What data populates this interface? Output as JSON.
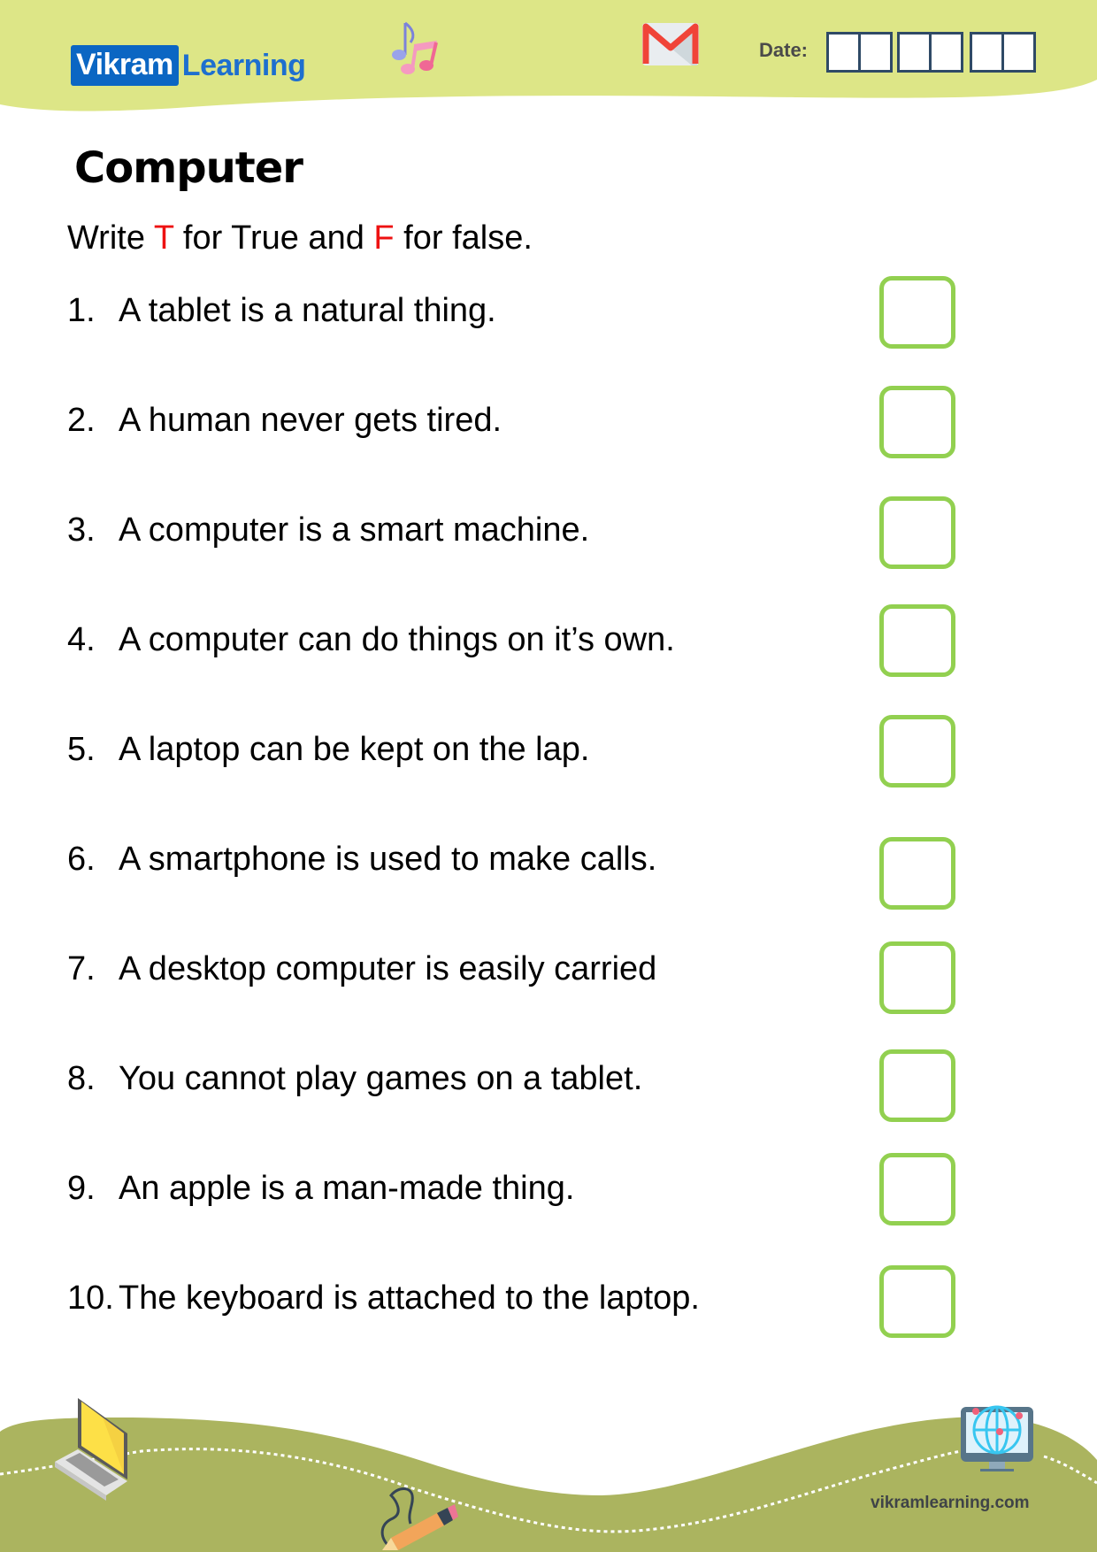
{
  "header": {
    "brand_box": "Vikram",
    "brand_text": "Learning",
    "date_label": "Date:",
    "date_groups": [
      2,
      2,
      2
    ]
  },
  "worksheet": {
    "title": "Computer",
    "instruction": {
      "part1": "Write ",
      "t": "T",
      "part2": " for True and ",
      "f": "F",
      "part3": " for false."
    },
    "questions": [
      {
        "num": "1.",
        "text": "A tablet is a natural thing."
      },
      {
        "num": "2.",
        "text": "A human never gets tired."
      },
      {
        "num": "3.",
        "text": "A computer is a smart machine."
      },
      {
        "num": "4.",
        "text": "A computer can do things on it’s own."
      },
      {
        "num": "5.",
        "text": "A laptop can be kept on the lap."
      },
      {
        "num": "6.",
        "text": "A smartphone is used to make calls."
      },
      {
        "num": "7.",
        "text": "A desktop computer is easily carried"
      },
      {
        "num": "8.",
        "text": "You cannot play games on a tablet."
      },
      {
        "num": "9.",
        "text": "An apple is a man-made thing."
      },
      {
        "num": "10.",
        "text": "The keyboard is attached to the laptop."
      }
    ]
  },
  "footer": {
    "website": "vikramlearning.com"
  },
  "colors": {
    "header_band": "#dde687",
    "footer_band": "#abb45f",
    "answer_box_border": "#92d050",
    "logo_blue": "#0b66c3",
    "highlight_red": "#ee1111",
    "date_box_border": "#2f4a66"
  },
  "icons": [
    "music-notes-icon",
    "gmail-icon",
    "laptop-icon",
    "pencil-icon",
    "globe-monitor-icon"
  ]
}
